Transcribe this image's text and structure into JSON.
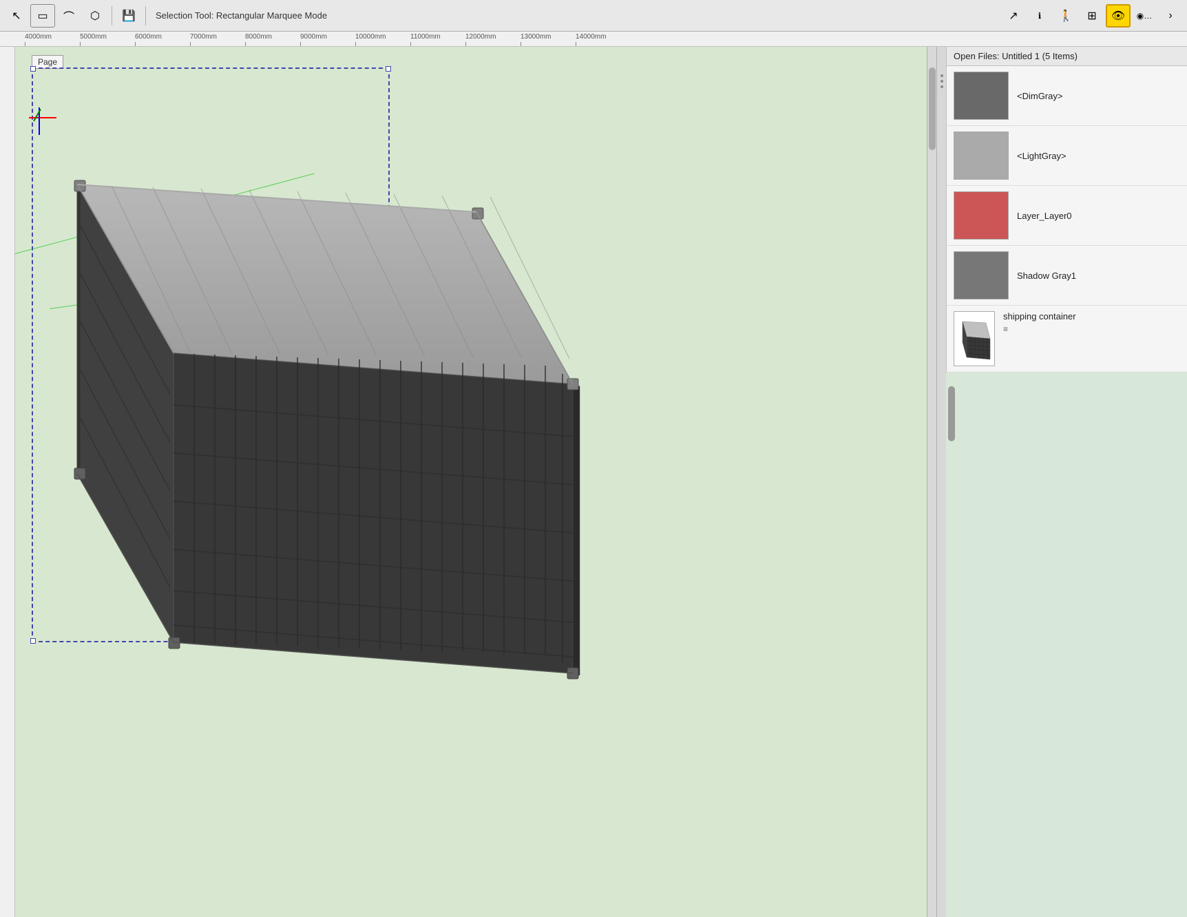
{
  "toolbar": {
    "title": "Selection Tool: Rectangular Marquee Mode",
    "tools": [
      {
        "name": "arrow-tool",
        "icon": "↖",
        "active": false
      },
      {
        "name": "rect-select-tool",
        "icon": "▭",
        "active": false
      },
      {
        "name": "lasso-tool",
        "icon": "⌒",
        "active": false
      },
      {
        "name": "poly-lasso-tool",
        "icon": "⬡",
        "active": false
      },
      {
        "name": "save-tool",
        "icon": "💾",
        "active": false
      },
      {
        "name": "cursor-tool",
        "icon": "↗",
        "active": false
      },
      {
        "name": "walk-tool",
        "icon": "👁",
        "active": false
      },
      {
        "name": "table-tool",
        "icon": "⊞",
        "active": false
      },
      {
        "name": "view-tool",
        "icon": "👁",
        "active": true
      },
      {
        "name": "style-tool",
        "icon": "◉",
        "active": false
      },
      {
        "name": "more-tool",
        "icon": "•••",
        "active": false
      },
      {
        "name": "expand-tool",
        "icon": "›",
        "active": false
      }
    ]
  },
  "ruler": {
    "ticks": [
      "4000mm",
      "5000mm",
      "6000mm",
      "7000mm",
      "8000mm",
      "9000mm",
      "10000mm",
      "11000mm",
      "12000mm",
      "13000mm",
      "14000mm"
    ]
  },
  "canvas": {
    "page_label": "Page",
    "axis_label": "Origin"
  },
  "panel": {
    "header": "Open Files: Untitled 1    (5 Items)",
    "items": [
      {
        "type": "color",
        "swatch": "dimgray",
        "label": "<DimGray>"
      },
      {
        "type": "color",
        "swatch": "lightgray",
        "label": "<LightGray>"
      },
      {
        "type": "color",
        "swatch": "red",
        "label": "Layer_Layer0"
      },
      {
        "type": "color",
        "swatch": "shadowgray",
        "label": "Shadow Gray1"
      },
      {
        "type": "component",
        "label": "shipping container",
        "sublabel": "≡"
      }
    ]
  }
}
